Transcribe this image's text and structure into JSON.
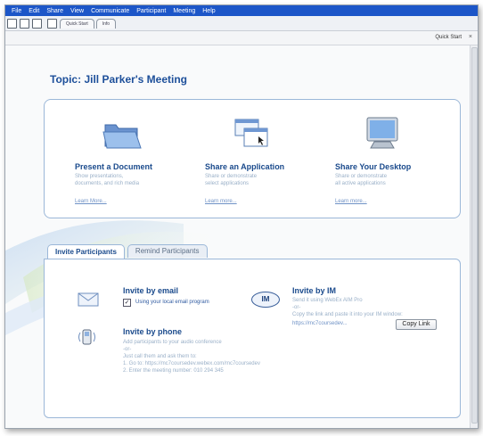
{
  "menu": [
    "File",
    "Edit",
    "Share",
    "View",
    "Communicate",
    "Participant",
    "Meeting",
    "Help"
  ],
  "toolbar_tabs": [
    "Quick Start",
    "Info"
  ],
  "subbar": {
    "label": "Quick Start",
    "close": "×"
  },
  "topic": {
    "title": "Topic: Jill Parker's Meeting"
  },
  "features": [
    {
      "title": "Present a Document",
      "desc1": "Show presentations,",
      "desc2": "documents, and rich media",
      "link": "Learn More..."
    },
    {
      "title": "Share an Application",
      "desc1": "Share or demonstrate",
      "desc2": "select applications",
      "link": "Learn more..."
    },
    {
      "title": "Share Your Desktop",
      "desc1": "Share or demonstrate",
      "desc2": "all active applications",
      "link": "Learn more..."
    }
  ],
  "tabs": {
    "invite": "Invite Participants",
    "remind": "Remind Participants"
  },
  "invite_email": {
    "title": "Invite by email",
    "checkbox_label": "Using your local email program",
    "checked": true
  },
  "invite_im": {
    "bubble": "IM",
    "title": "Invite by IM",
    "line1": "Send it using WebEx AIM Pro",
    "line2": "-or-",
    "line3": "Copy the link and paste it into your IM window:",
    "link": "https://mc7coursedev...",
    "copy_button": "Copy Link"
  },
  "invite_phone": {
    "title": "Invite by phone",
    "line1": "Add participants to your audio conference",
    "line2": "-or-",
    "line3": "Just call them and ask them to:",
    "line4": "1. Go to: https://mc7coursedev.webex.com/mc7coursedev",
    "line5": "2. Enter the meeting number: 010 294 345"
  },
  "colors": {
    "menubar": "#1c56c8",
    "title": "#1a4a8c",
    "panel_border": "#9bb7d8",
    "link": "#6f92c6"
  }
}
